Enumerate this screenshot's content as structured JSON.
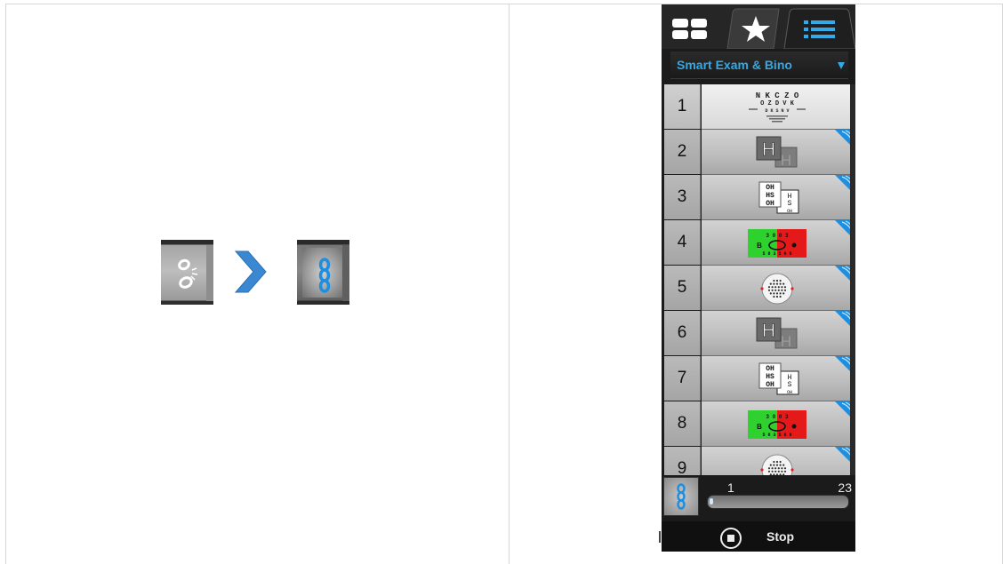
{
  "colors": {
    "accent": "#35a9e6",
    "arrow": "#3a88d2",
    "red_green_left": "#2fd12f",
    "red_green_right": "#e41a1a"
  },
  "illustration": {
    "before_icon": "unlinked-chain-icon",
    "after_icon": "linked-chain-icon",
    "arrow_icon": "chevron-right-icon"
  },
  "tabs": [
    {
      "icon": "grid-icon"
    },
    {
      "icon": "star-icon"
    },
    {
      "icon": "list-icon",
      "active": true
    }
  ],
  "program": {
    "selected": "Smart Exam & Bino"
  },
  "tests": [
    {
      "number": "1",
      "thumb": "letter-chart",
      "selected": true,
      "chart_lines": [
        "N K C Z O",
        "O Z D V K",
        "D K S N V"
      ]
    },
    {
      "number": "2",
      "thumb": "h-dissociation",
      "glyph": "H"
    },
    {
      "number": "3",
      "thumb": "polarized-letters",
      "left_letters": [
        "OH",
        "HS",
        "OH"
      ],
      "right_letters": [
        "H",
        "S",
        "OH"
      ]
    },
    {
      "number": "4",
      "thumb": "red-green",
      "top": "3 0   0 3",
      "middle": "B",
      "bottom": "5 8 3 5 6 9"
    },
    {
      "number": "5",
      "thumb": "dot-target"
    },
    {
      "number": "6",
      "thumb": "h-dissociation",
      "glyph": "H"
    },
    {
      "number": "7",
      "thumb": "polarized-letters",
      "left_letters": [
        "OH",
        "HS",
        "OH"
      ],
      "right_letters": [
        "H",
        "S",
        "OH"
      ]
    },
    {
      "number": "8",
      "thumb": "red-green",
      "top": "3 0   0 3",
      "middle": "B",
      "bottom": "5 8 3 5 6 9"
    },
    {
      "number": "9",
      "thumb": "dot-target"
    }
  ],
  "progress": {
    "min": "1",
    "max": "23",
    "value": 1,
    "total": 23
  },
  "stop": {
    "label": "Stop"
  }
}
